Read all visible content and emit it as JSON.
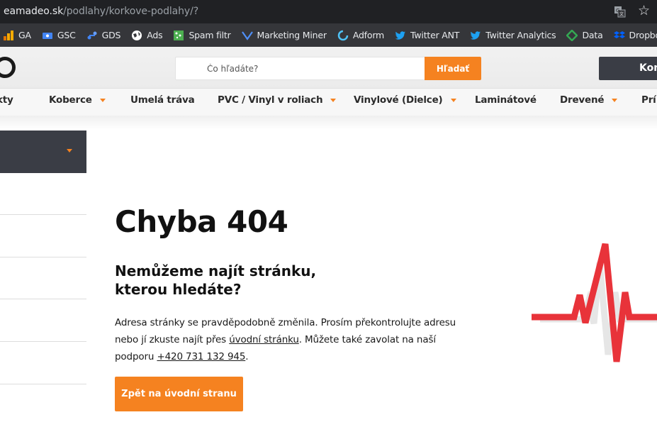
{
  "browser": {
    "url_host": "eamadeo.sk",
    "url_path": "/podlahy/korkove-podlahy/?",
    "bookmarks": [
      {
        "label": "GA",
        "icon": "analytics-icon",
        "color": "#f9ab00"
      },
      {
        "label": "GSC",
        "icon": "search-console-icon",
        "color": "#4285f4"
      },
      {
        "label": "GDS",
        "icon": "data-studio-icon",
        "color": "#4285f4"
      },
      {
        "label": "Ads",
        "icon": "globe-icon",
        "color": "#ffffff"
      },
      {
        "label": "Spam filtr",
        "icon": "spam-filter-icon",
        "color": "#4caf50"
      },
      {
        "label": "Marketing Miner",
        "icon": "check-icon",
        "color": "#4f8ff7"
      },
      {
        "label": "Adform",
        "icon": "adform-icon",
        "color": "#4fc3f7"
      },
      {
        "label": "Twitter ANT",
        "icon": "twitter-icon",
        "color": "#1da1f2"
      },
      {
        "label": "Twitter Analytics",
        "icon": "twitter-icon",
        "color": "#1da1f2"
      },
      {
        "label": "Data",
        "icon": "diamond-icon",
        "color": "#34a853"
      },
      {
        "label": "Dropbox",
        "icon": "dropbox-icon",
        "color": "#0061ff"
      }
    ]
  },
  "header": {
    "search_placeholder": "Čo hľadáte?",
    "search_button": "Hľadať",
    "contact_label": "Kontakt"
  },
  "nav": {
    "items": [
      {
        "label": "kty",
        "has_dropdown": false
      },
      {
        "label": "Koberce",
        "has_dropdown": true
      },
      {
        "label": "Umelá tráva",
        "has_dropdown": false
      },
      {
        "label": "PVC / Vinyl v roliach",
        "has_dropdown": true
      },
      {
        "label": "Vinylové (Dielce)",
        "has_dropdown": true
      },
      {
        "label": "Laminátové",
        "has_dropdown": false
      },
      {
        "label": "Drevené",
        "has_dropdown": true
      },
      {
        "label": "Prí",
        "has_dropdown": false
      }
    ]
  },
  "error": {
    "title": "Chyba 404",
    "subtitle": "Nemůžeme najít stránku, kterou hledáte?",
    "message_part1": "Adresa stránky se pravděpodobně změnila. Prosím překontrolujte adresu nebo jí zkuste najít přes ",
    "homepage_link": "úvodní stránku",
    "message_part2": ". Můžete také zavolat na naší podporu ",
    "phone_link": "+420 731 132 945",
    "message_part3": ".",
    "home_button": "Zpět na úvodní stranu"
  },
  "colors": {
    "accent": "#f58220",
    "dark": "#3a3d45",
    "heartbeat": "#e8333a"
  }
}
